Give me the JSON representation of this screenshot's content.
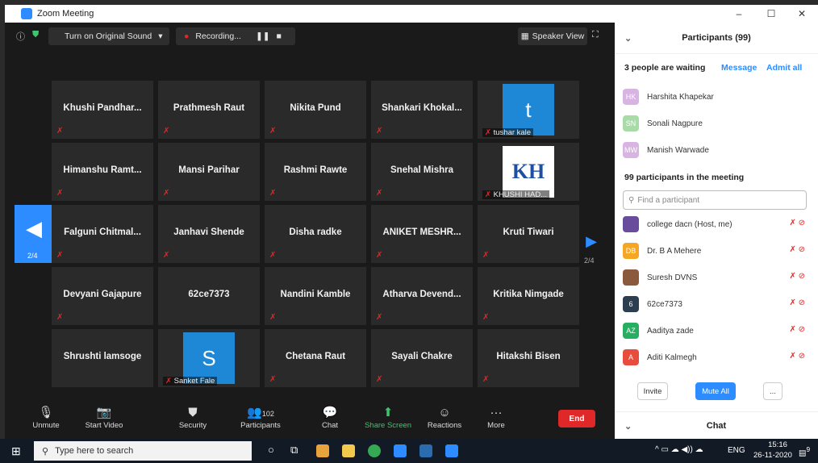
{
  "window": {
    "title": "Zoom Meeting",
    "controls": [
      "–",
      "☐",
      "✕"
    ]
  },
  "topbar": {
    "original_sound": "Turn on Original Sound",
    "recording": "Recording...",
    "speaker_view": "Speaker View"
  },
  "grid": {
    "tiles": [
      {
        "name": "Khushi  Pandhar...",
        "muted": true
      },
      {
        "name": "Prathmesh Raut",
        "muted": true
      },
      {
        "name": "Nikita Pund",
        "muted": true
      },
      {
        "name": "Shankari  Khokal...",
        "muted": true
      },
      {
        "tag": "tushar kale",
        "avatar": "t",
        "avatar_color": "#1e88d6",
        "muted": true
      },
      {
        "name": "Himanshu  Ramt...",
        "muted": true
      },
      {
        "name": "Mansi Parihar",
        "muted": true
      },
      {
        "name": "Rashmi Rawte",
        "muted": true
      },
      {
        "name": "Snehal Mishra",
        "muted": true
      },
      {
        "tag": "KHUSHI HAD...",
        "logo": "KH",
        "muted": true
      },
      {
        "name": "Falguni  Chitmal...",
        "muted": true
      },
      {
        "name": "Janhavi Shende",
        "muted": true
      },
      {
        "name": "Disha radke",
        "muted": true
      },
      {
        "name": "ANIKET  MESHR...",
        "muted": true
      },
      {
        "name": "Kruti Tiwari",
        "muted": true
      },
      {
        "name": "Devyani Gajapure",
        "muted": true
      },
      {
        "name": "62ce7373",
        "muted": false
      },
      {
        "name": "Nandini Kamble",
        "muted": true
      },
      {
        "name": "Atharva  Devend...",
        "muted": true
      },
      {
        "name": "Kritika Nimgade",
        "muted": true
      },
      {
        "name": "Shrushti lamsoge",
        "muted": false
      },
      {
        "tag": "Sanket Fale",
        "avatar": "S",
        "avatar_color": "#1e88d6",
        "muted": true
      },
      {
        "name": "Chetana Raut",
        "muted": true
      },
      {
        "name": "Sayali Chakre",
        "muted": true
      },
      {
        "name": "Hitakshi Bisen",
        "muted": true
      }
    ],
    "page_left": "2/4",
    "page_right": "2/4"
  },
  "toolbar": {
    "unmute": "Unmute",
    "start_video": "Start Video",
    "security": "Security",
    "participants": "Participants",
    "participants_count": "102",
    "chat": "Chat",
    "share_screen": "Share Screen",
    "reactions": "Reactions",
    "more": "More",
    "end": "End"
  },
  "panel": {
    "title": "Participants (99)",
    "waiting_label": "3 people are waiting",
    "message": "Message",
    "admit_all": "Admit all",
    "waiting": [
      {
        "initials": "HK",
        "name": "Harshita Khapekar",
        "color": "#d8b4e2"
      },
      {
        "initials": "SN",
        "name": "Sonali Nagpure",
        "color": "#a8dba8"
      },
      {
        "initials": "MW",
        "name": "Manish Warwade",
        "color": "#d8b4e2"
      }
    ],
    "in_meeting_label": "99 participants in the meeting",
    "search_placeholder": "Find a participant",
    "participants": [
      {
        "initials": "",
        "name": "college dacn (Host, me)",
        "color": "#6a4c9c"
      },
      {
        "initials": "DB",
        "name": "Dr. B A  Mehere",
        "color": "#f5a623"
      },
      {
        "initials": "",
        "name": "Suresh DVNS",
        "color": "#8b5a3c"
      },
      {
        "initials": "6",
        "name": "62ce7373",
        "color": "#2c3e50"
      },
      {
        "initials": "AZ",
        "name": "Aaditya zade",
        "color": "#27ae60"
      },
      {
        "initials": "A",
        "name": "Aditi Kalmegh",
        "color": "#e74c3c"
      }
    ],
    "invite": "Invite",
    "mute_all": "Mute All",
    "more": "...",
    "chat": "Chat"
  },
  "taskbar": {
    "search": "Type here to search",
    "lang": "ENG",
    "time": "15:16",
    "date": "26-11-2020",
    "notif": "9"
  }
}
